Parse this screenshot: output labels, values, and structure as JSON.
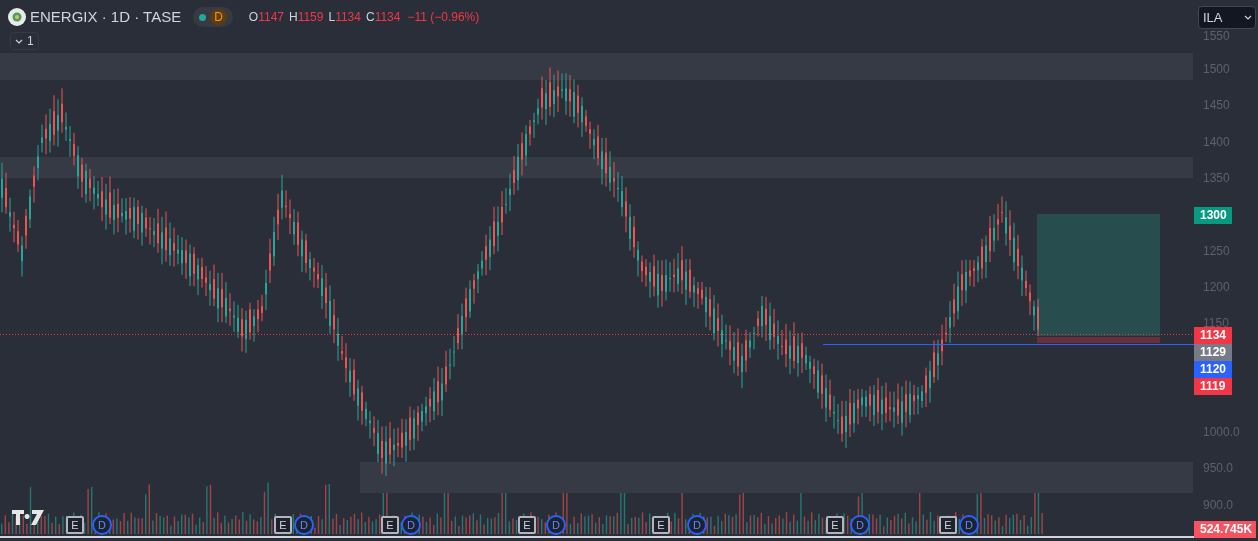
{
  "header": {
    "symbol": "ENERGIX · 1D · TASE",
    "market_status": "D",
    "ohlc": [
      {
        "label": "O",
        "value": "1147"
      },
      {
        "label": "H",
        "value": "1159"
      },
      {
        "label": "L",
        "value": "1134"
      },
      {
        "label": "C",
        "value": "1134"
      }
    ],
    "change": "−11 (−0.96%)",
    "indicator_toggle": "1"
  },
  "currency_select": {
    "value": "ILA"
  },
  "price_tags": [
    {
      "text": "1300",
      "color": "#089981"
    },
    {
      "text": "1134",
      "color": "#f23645"
    },
    {
      "text": "1129",
      "color": "#787b86"
    },
    {
      "text": "1120",
      "color": "#2962ff"
    },
    {
      "text": "1119",
      "color": "#f23645"
    },
    {
      "text": "524.745K",
      "color": "#f7525f"
    }
  ],
  "events": [
    {
      "kind": "earnings",
      "label": "E"
    },
    {
      "kind": "dividend",
      "label": "D"
    },
    {
      "kind": "earnings",
      "label": "E"
    },
    {
      "kind": "dividend",
      "label": "D"
    },
    {
      "kind": "earnings",
      "label": "E"
    },
    {
      "kind": "dividend",
      "label": "D"
    },
    {
      "kind": "earnings",
      "label": "E"
    },
    {
      "kind": "dividend",
      "label": "D"
    },
    {
      "kind": "earnings",
      "label": "E"
    },
    {
      "kind": "dividend",
      "label": "D"
    },
    {
      "kind": "earnings",
      "label": "E"
    },
    {
      "kind": "dividend",
      "label": "D"
    },
    {
      "kind": "earnings",
      "label": "E"
    },
    {
      "kind": "dividend",
      "label": "D"
    }
  ],
  "price_axis": {
    "labels": [
      "1550",
      "1500",
      "1450",
      "1400",
      "1350",
      "1250",
      "1200",
      "1150",
      "1000.0",
      "950.0",
      "900.0"
    ]
  }
}
